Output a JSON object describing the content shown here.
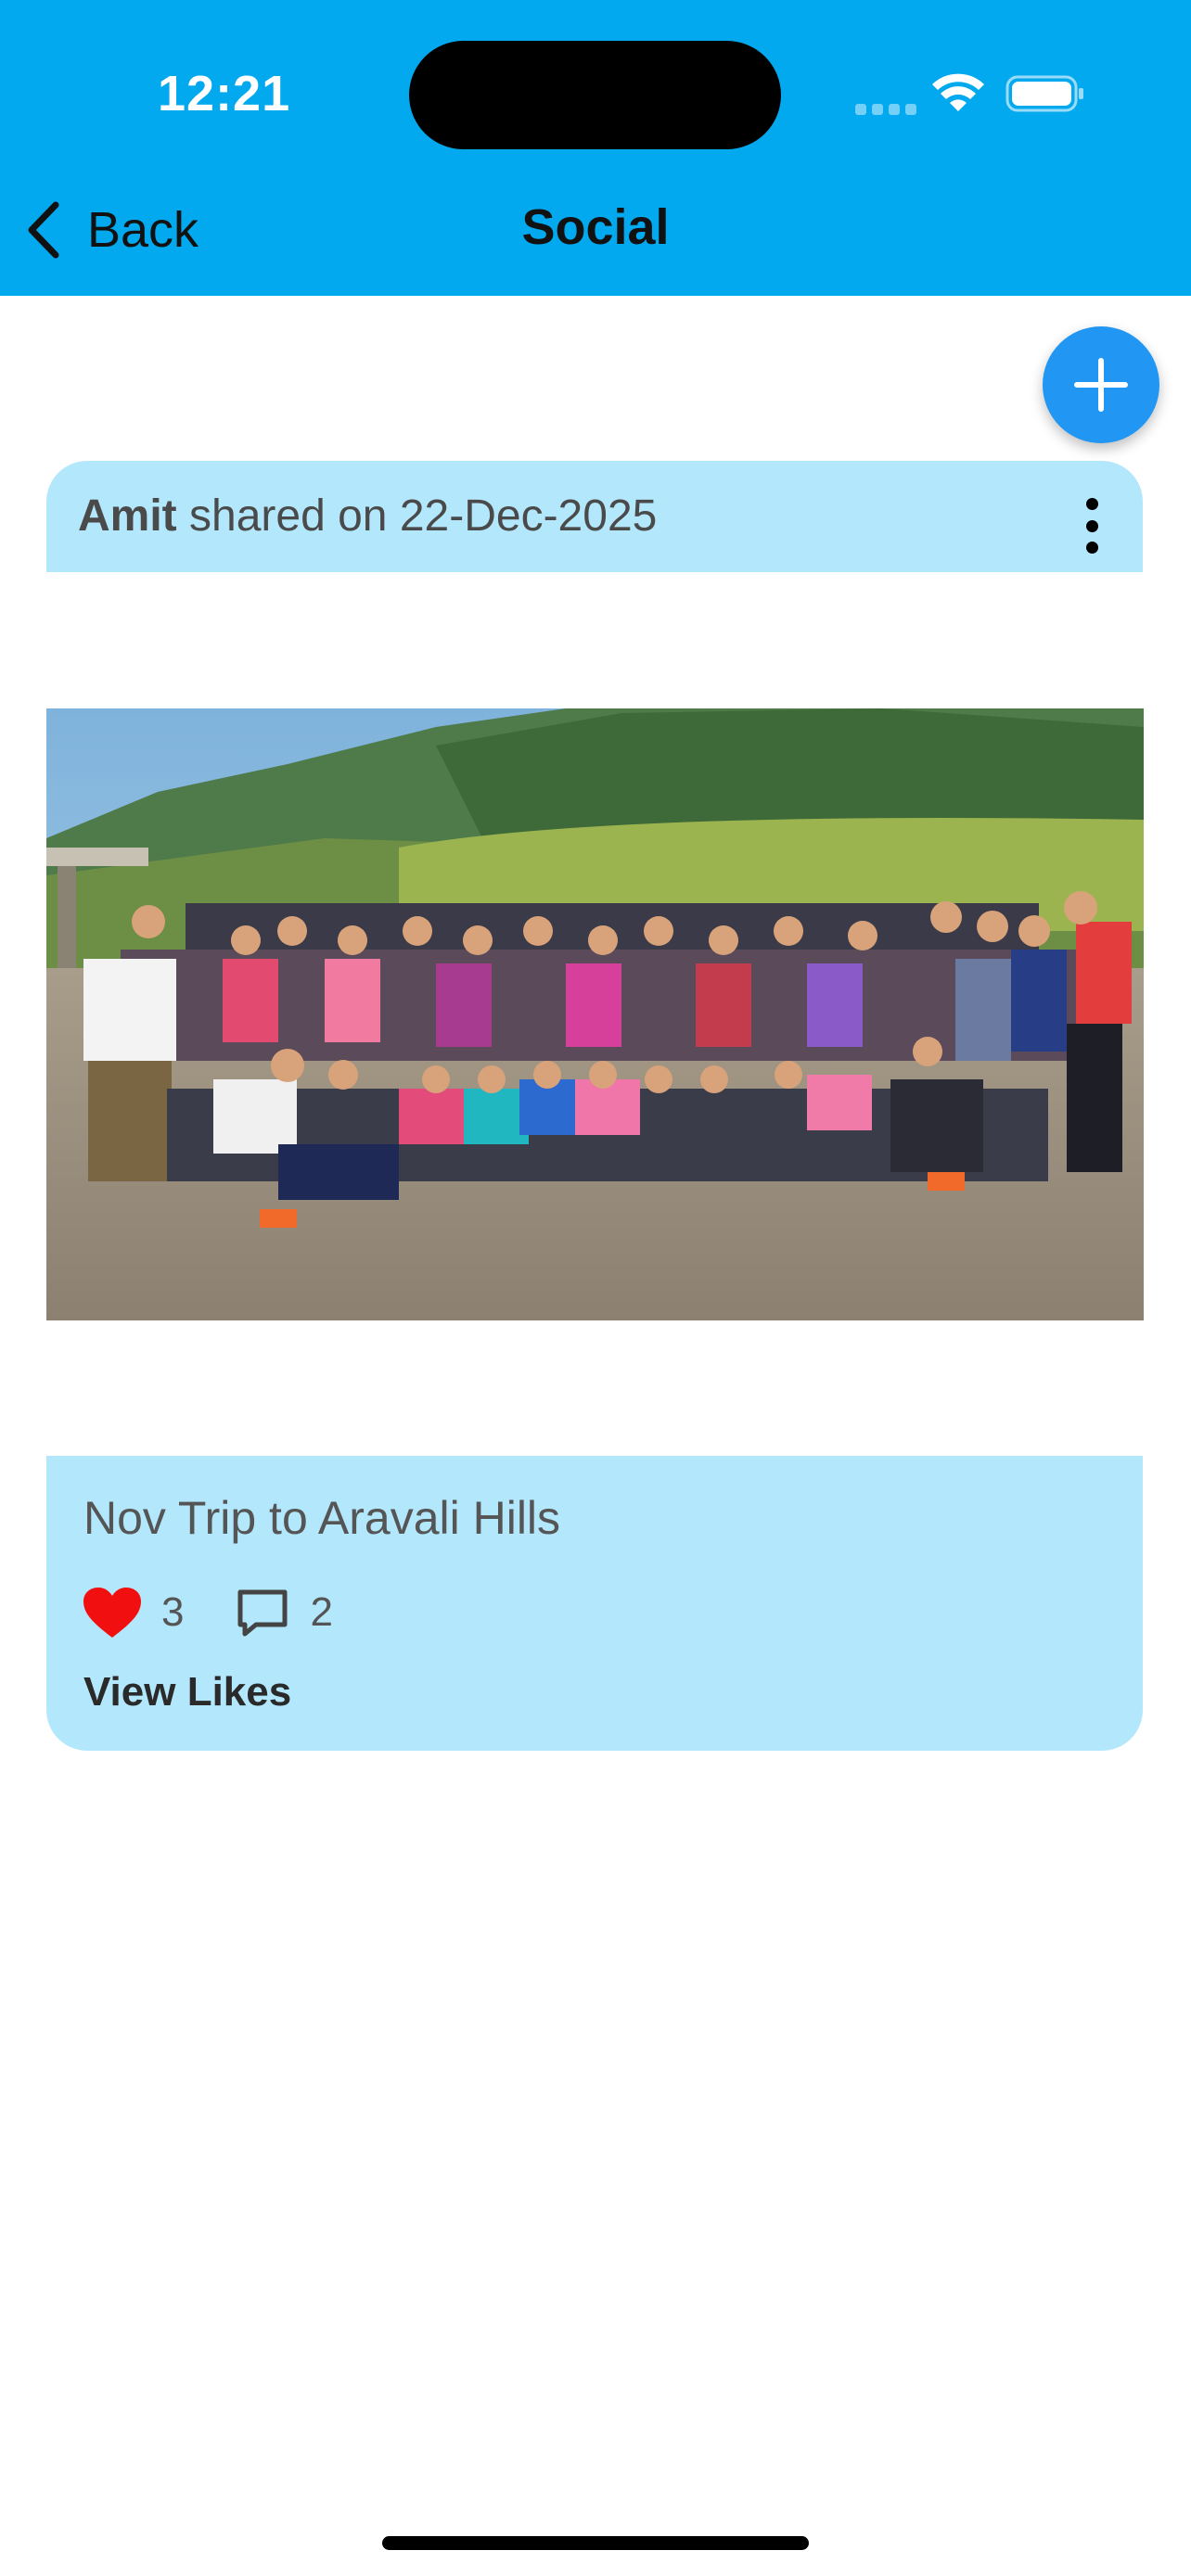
{
  "status_bar": {
    "time": "12:21"
  },
  "nav": {
    "back_label": "Back",
    "title": "Social"
  },
  "fab": {
    "icon": "plus-icon"
  },
  "post": {
    "author": "Amit",
    "shared_text": " shared on 22-Dec-2025",
    "image_description": "group-photo",
    "caption": "Nov Trip to Aravali Hills",
    "like_count": "3",
    "comment_count": "2",
    "view_likes_label": "View Likes"
  },
  "colors": {
    "header": "#03a9ee",
    "card": "#b3e7fc",
    "fab": "#2196f3",
    "heart": "#f20f0f"
  }
}
